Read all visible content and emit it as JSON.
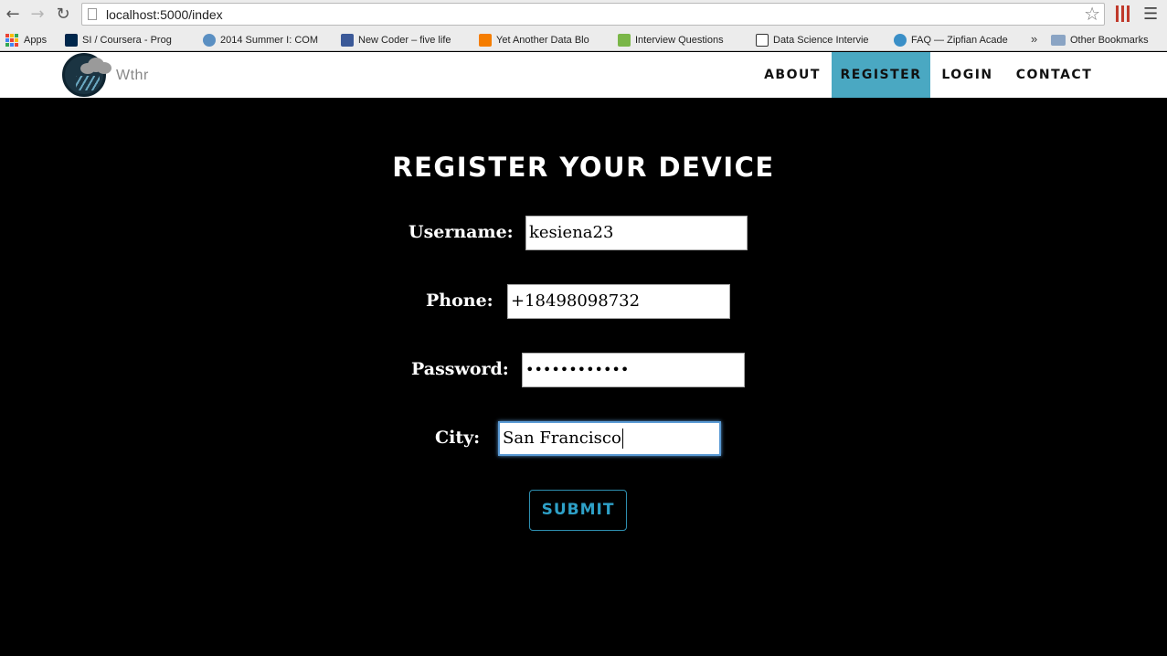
{
  "browser": {
    "url": "localhost:5000/index",
    "bookmarks": [
      {
        "label": "Apps",
        "color": "#4285f4"
      },
      {
        "label": "SI / Coursera - Prog",
        "color": "#ffcb05"
      },
      {
        "label": "2014 Summer I: COM",
        "color": "#5a8fc2"
      },
      {
        "label": "New Coder – five life",
        "color": "#3b5998"
      },
      {
        "label": "Yet Another Data Blo",
        "color": "#f57d00"
      },
      {
        "label": "Interview Questions",
        "color": "#7ab648"
      },
      {
        "label": "Data Science Intervie",
        "color": "#333333"
      },
      {
        "label": "FAQ — Zipfian Acade",
        "color": "#3a8fc7"
      }
    ],
    "more_label": "»",
    "other_bookmarks_label": "Other Bookmarks"
  },
  "site": {
    "logo_text": "Wthr",
    "nav": [
      {
        "label": "ABOUT",
        "active": false
      },
      {
        "label": "REGISTER",
        "active": true
      },
      {
        "label": "LOGIN",
        "active": false
      },
      {
        "label": "CONTACT",
        "active": false
      }
    ],
    "accent_color": "#4aa8c2"
  },
  "form": {
    "title": "REGISTER YOUR DEVICE",
    "username_label": "Username:",
    "username_value": "kesiena23",
    "phone_label": "Phone:",
    "phone_value": "+18498098732",
    "password_label": "Password:",
    "password_value": "••••••••••••",
    "city_label": "City:",
    "city_value": "San Francisco",
    "submit_label": "SUBMIT"
  }
}
